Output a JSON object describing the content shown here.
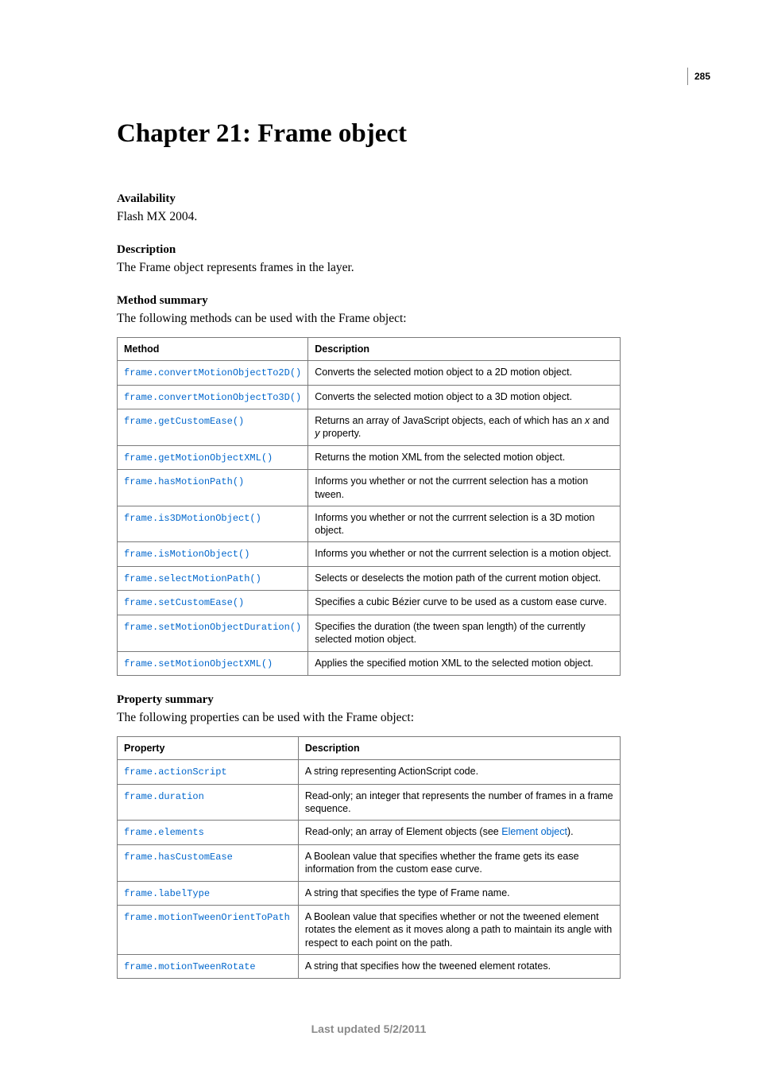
{
  "page_number": "285",
  "chapter_title": "Chapter 21: Frame object",
  "availability": {
    "label": "Availability",
    "text": "Flash MX 2004."
  },
  "description": {
    "label": "Description",
    "text": "The Frame object represents frames in the layer."
  },
  "method_summary": {
    "label": "Method summary",
    "intro": "The following methods can be used with the Frame object:",
    "headers": {
      "method": "Method",
      "description": "Description"
    },
    "rows": [
      {
        "method": "frame.convertMotionObjectTo2D()",
        "desc": "Converts the selected motion object to a 2D motion object."
      },
      {
        "method": "frame.convertMotionObjectTo3D()",
        "desc": "Converts the selected motion object to a 3D motion object."
      },
      {
        "method": "frame.getCustomEase()",
        "desc_pre": "Returns an array of JavaScript objects, each of which has an ",
        "italic1": "x",
        "mid": " and ",
        "italic2": "y",
        "desc_post": " property."
      },
      {
        "method": "frame.getMotionObjectXML()",
        "desc": "Returns the motion XML from the selected motion object."
      },
      {
        "method": "frame.hasMotionPath()",
        "desc": "Informs you whether or not the currrent selection has a motion tween."
      },
      {
        "method": "frame.is3DMotionObject()",
        "desc": "Informs you whether or not the currrent selection is a 3D motion object."
      },
      {
        "method": "frame.isMotionObject()",
        "desc": "Informs you whether or not the currrent selection is a motion object."
      },
      {
        "method": "frame.selectMotionPath()",
        "desc": "Selects or deselects the motion path of the current motion object."
      },
      {
        "method": "frame.setCustomEase()",
        "desc": "Specifies a cubic Bézier curve to be used as a custom ease curve."
      },
      {
        "method": "frame.setMotionObjectDuration()",
        "desc": "Specifies the duration (the tween span length) of the currently selected motion object."
      },
      {
        "method": "frame.setMotionObjectXML()",
        "desc": "Applies the specified motion XML to the selected motion object."
      }
    ]
  },
  "property_summary": {
    "label": "Property summary",
    "intro": "The following properties can be used with the Frame object:",
    "headers": {
      "property": "Property",
      "description": "Description"
    },
    "rows": [
      {
        "property": "frame.actionScript",
        "desc": "A string representing ActionScript code."
      },
      {
        "property": "frame.duration",
        "desc": "Read-only; an integer that represents the number of frames in a frame sequence."
      },
      {
        "property": "frame.elements",
        "desc_pre": "Read-only; an array of Element objects (see ",
        "link": "Element object",
        "desc_post": ")."
      },
      {
        "property": "frame.hasCustomEase",
        "desc": "A Boolean value that specifies whether the frame gets its ease information from the custom ease curve."
      },
      {
        "property": "frame.labelType",
        "desc": "A string that specifies the type of Frame name."
      },
      {
        "property": "frame.motionTweenOrientToPath",
        "desc": "A Boolean value that specifies whether or not the tweened element rotates the element as it moves along a path to maintain its angle with respect to each point on the path."
      },
      {
        "property": "frame.motionTweenRotate",
        "desc": "A string that specifies how the tweened element rotates."
      }
    ]
  },
  "footer": "Last updated 5/2/2011"
}
